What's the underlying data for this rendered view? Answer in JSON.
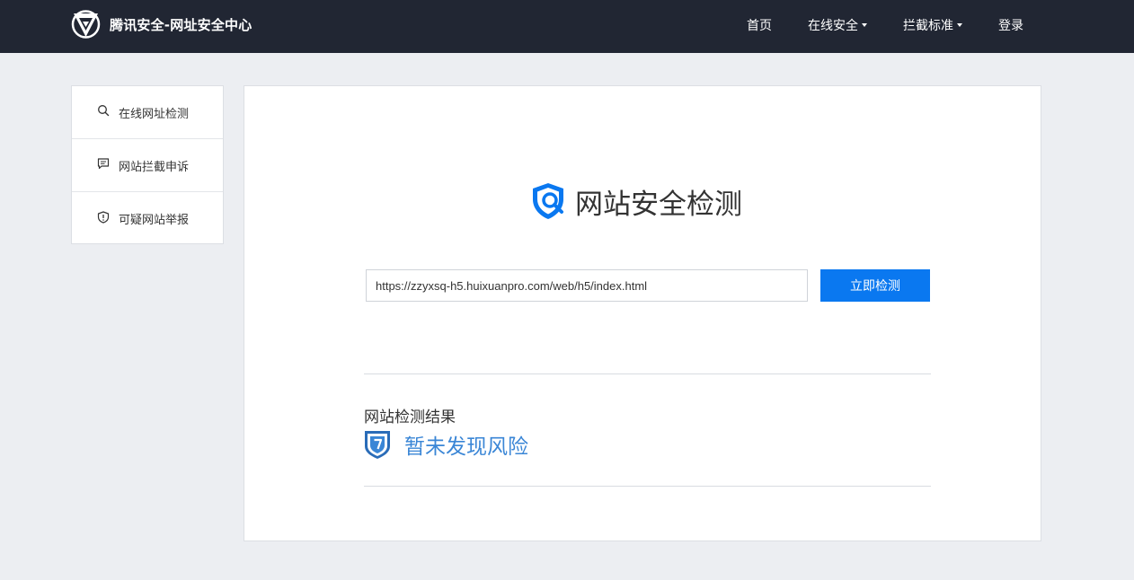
{
  "header": {
    "brand_title": "腾讯安全-网址安全中心",
    "logo_icon": "tencent-security-logo-icon",
    "nav": {
      "home": "首页",
      "online_security": "在线安全",
      "block_standard": "拦截标准",
      "login": "登录"
    }
  },
  "sidebar": {
    "items": [
      {
        "label": "在线网址检测",
        "icon": "search-icon"
      },
      {
        "label": "网站拦截申诉",
        "icon": "chat-bubble-icon"
      },
      {
        "label": "可疑网站举报",
        "icon": "shield-alert-icon"
      }
    ]
  },
  "main": {
    "heading": "网站安全检测",
    "heading_icon": "shield-search-icon",
    "url_value": "https://zzyxsq-h5.huixuanpro.com/web/h5/index.html",
    "check_button": "立即检测",
    "result_label": "网站检测结果",
    "result_text": "暂未发现风险",
    "result_icon": "shield-question-icon"
  },
  "colors": {
    "topbar": "#212633",
    "accent_blue": "#0a78f0",
    "result_blue": "#3a86d6",
    "page_bg": "#eceef2"
  }
}
